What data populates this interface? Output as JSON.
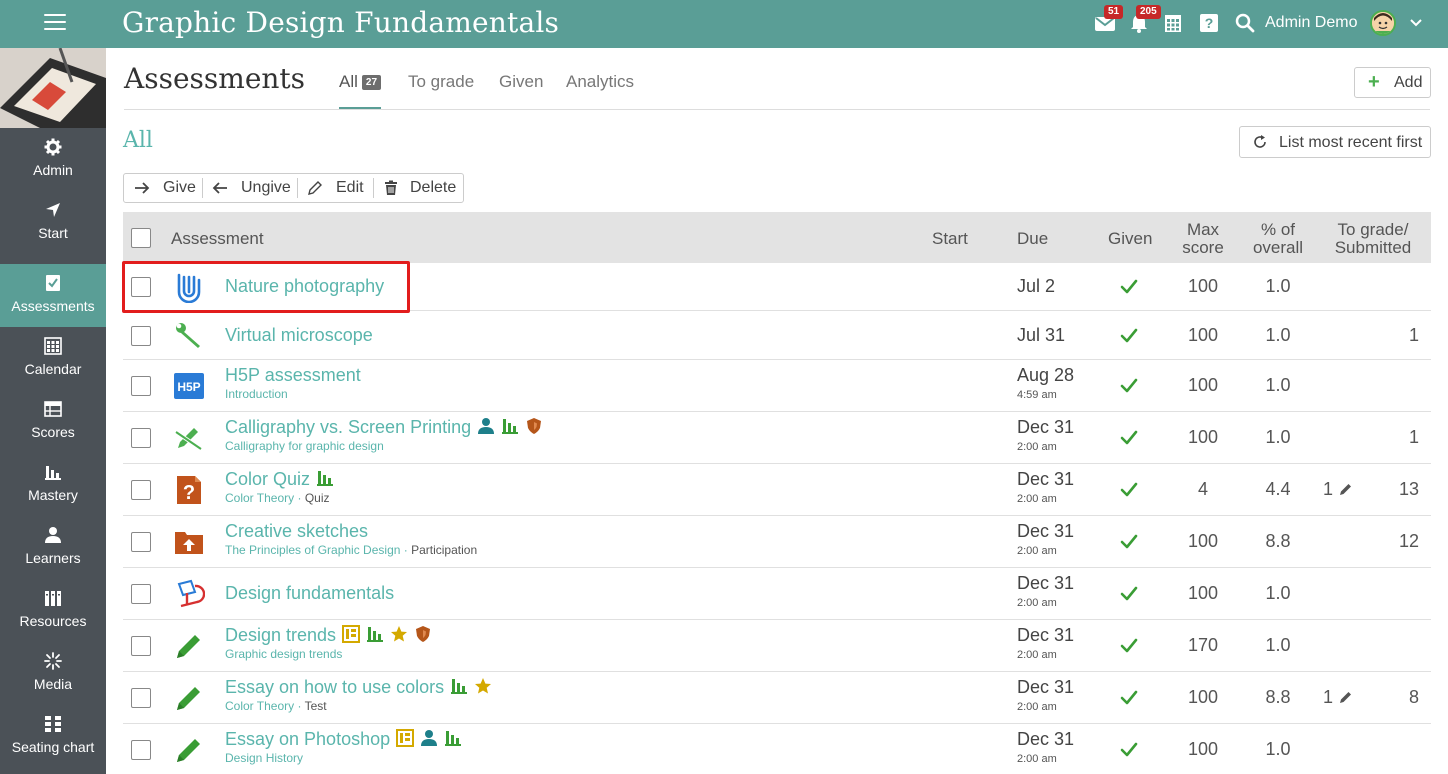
{
  "app": {
    "title": "Graphic Design Fundamentals",
    "user_name": "Admin Demo",
    "notifications": {
      "messages_count": "51",
      "alerts_count": "205"
    },
    "accent_color": "#5a9e96",
    "link_color": "#5ab5ac"
  },
  "sidebar": {
    "items": [
      {
        "label": "Admin",
        "icon": "gear-icon"
      },
      {
        "label": "Start",
        "icon": "navigation-arrow-icon"
      },
      {
        "label": "Assessments",
        "icon": "checklist-icon",
        "active": true
      },
      {
        "label": "Calendar",
        "icon": "calendar-icon"
      },
      {
        "label": "Scores",
        "icon": "scores-icon"
      },
      {
        "label": "Mastery",
        "icon": "bar-chart-icon"
      },
      {
        "label": "Learners",
        "icon": "person-icon"
      },
      {
        "label": "Resources",
        "icon": "books-icon"
      },
      {
        "label": "Media",
        "icon": "media-icon"
      },
      {
        "label": "Seating chart",
        "icon": "seating-chart-icon"
      }
    ]
  },
  "page": {
    "title": "Assessments",
    "tabs": [
      {
        "label": "All",
        "count": "27",
        "active": true
      },
      {
        "label": "To grade"
      },
      {
        "label": "Given"
      },
      {
        "label": "Analytics"
      }
    ],
    "add_label": "Add",
    "section_title": "All",
    "sort_label": "List most recent first"
  },
  "toolbar": {
    "give": "Give",
    "ungive": "Ungive",
    "edit": "Edit",
    "delete": "Delete"
  },
  "table": {
    "headers": {
      "assessment": "Assessment",
      "start": "Start",
      "due": "Due",
      "given": "Given",
      "max_score_1": "Max",
      "max_score_2": "score",
      "pct_1": "% of",
      "pct_2": "overall",
      "tograde_1": "To grade/",
      "tograde_2": "Submitted"
    },
    "rows": [
      {
        "name": "Nature photography",
        "icon": "attachment-icon",
        "subtitle": "",
        "type": "",
        "due": "Jul 2",
        "due_time": "",
        "given": true,
        "max": "100",
        "pct": "1.0",
        "to_grade": "",
        "submitted": "",
        "tags": []
      },
      {
        "name": "Virtual microscope",
        "icon": "wrench-icon",
        "subtitle": "",
        "type": "",
        "due": "Jul 31",
        "due_time": "",
        "given": true,
        "max": "100",
        "pct": "1.0",
        "to_grade": "",
        "submitted": "1",
        "tags": []
      },
      {
        "name": "H5P assessment",
        "icon": "h5p-icon",
        "subtitle": "Introduction",
        "type": "",
        "due": "Aug 28",
        "due_time": "4:59 am",
        "given": true,
        "max": "100",
        "pct": "1.0",
        "to_grade": "",
        "submitted": "",
        "tags": []
      },
      {
        "name": "Calligraphy vs. Screen Printing",
        "icon": "no-pencil-icon",
        "subtitle": "Calligraphy for graphic design",
        "type": "",
        "due": "Dec 31",
        "due_time": "2:00 am",
        "given": true,
        "max": "100",
        "pct": "1.0",
        "to_grade": "",
        "submitted": "1",
        "tags": [
          "person-icon",
          "bar-chart-icon",
          "shield-icon"
        ]
      },
      {
        "name": "Color Quiz",
        "icon": "question-icon",
        "subtitle": "Color Theory",
        "type": "Quiz",
        "due": "Dec 31",
        "due_time": "2:00 am",
        "given": true,
        "max": "4",
        "pct": "4.4",
        "to_grade": "1",
        "submitted": "13",
        "tags": [
          "bar-chart-icon"
        ]
      },
      {
        "name": "Creative sketches",
        "icon": "upload-folder-icon",
        "subtitle": "The Principles of Graphic Design",
        "type": "Participation",
        "due": "Dec 31",
        "due_time": "2:00 am",
        "given": true,
        "max": "100",
        "pct": "8.8",
        "to_grade": "",
        "submitted": "12",
        "tags": []
      },
      {
        "name": "Design fundamentals",
        "icon": "turnitin-icon",
        "subtitle": "",
        "type": "",
        "due": "Dec 31",
        "due_time": "2:00 am",
        "given": true,
        "max": "100",
        "pct": "1.0",
        "to_grade": "",
        "submitted": "",
        "tags": []
      },
      {
        "name": "Design trends",
        "icon": "pencil-icon",
        "subtitle": "Graphic design trends",
        "type": "",
        "due": "Dec 31",
        "due_time": "2:00 am",
        "given": true,
        "max": "170",
        "pct": "1.0",
        "to_grade": "",
        "submitted": "",
        "tags": [
          "rubric-icon",
          "bar-chart-icon",
          "star-icon",
          "shield-icon"
        ]
      },
      {
        "name": "Essay on how to use colors",
        "icon": "pencil-icon",
        "subtitle": "Color Theory",
        "type": "Test",
        "due": "Dec 31",
        "due_time": "2:00 am",
        "given": true,
        "max": "100",
        "pct": "8.8",
        "to_grade": "1",
        "submitted": "8",
        "tags": [
          "bar-chart-icon",
          "star-icon"
        ]
      },
      {
        "name": "Essay on Photoshop",
        "icon": "pencil-icon",
        "subtitle": "Design History",
        "type": "",
        "due": "Dec 31",
        "due_time": "2:00 am",
        "given": true,
        "max": "100",
        "pct": "1.0",
        "to_grade": "",
        "submitted": "",
        "tags": [
          "rubric-icon",
          "person-icon",
          "bar-chart-icon"
        ]
      }
    ]
  }
}
